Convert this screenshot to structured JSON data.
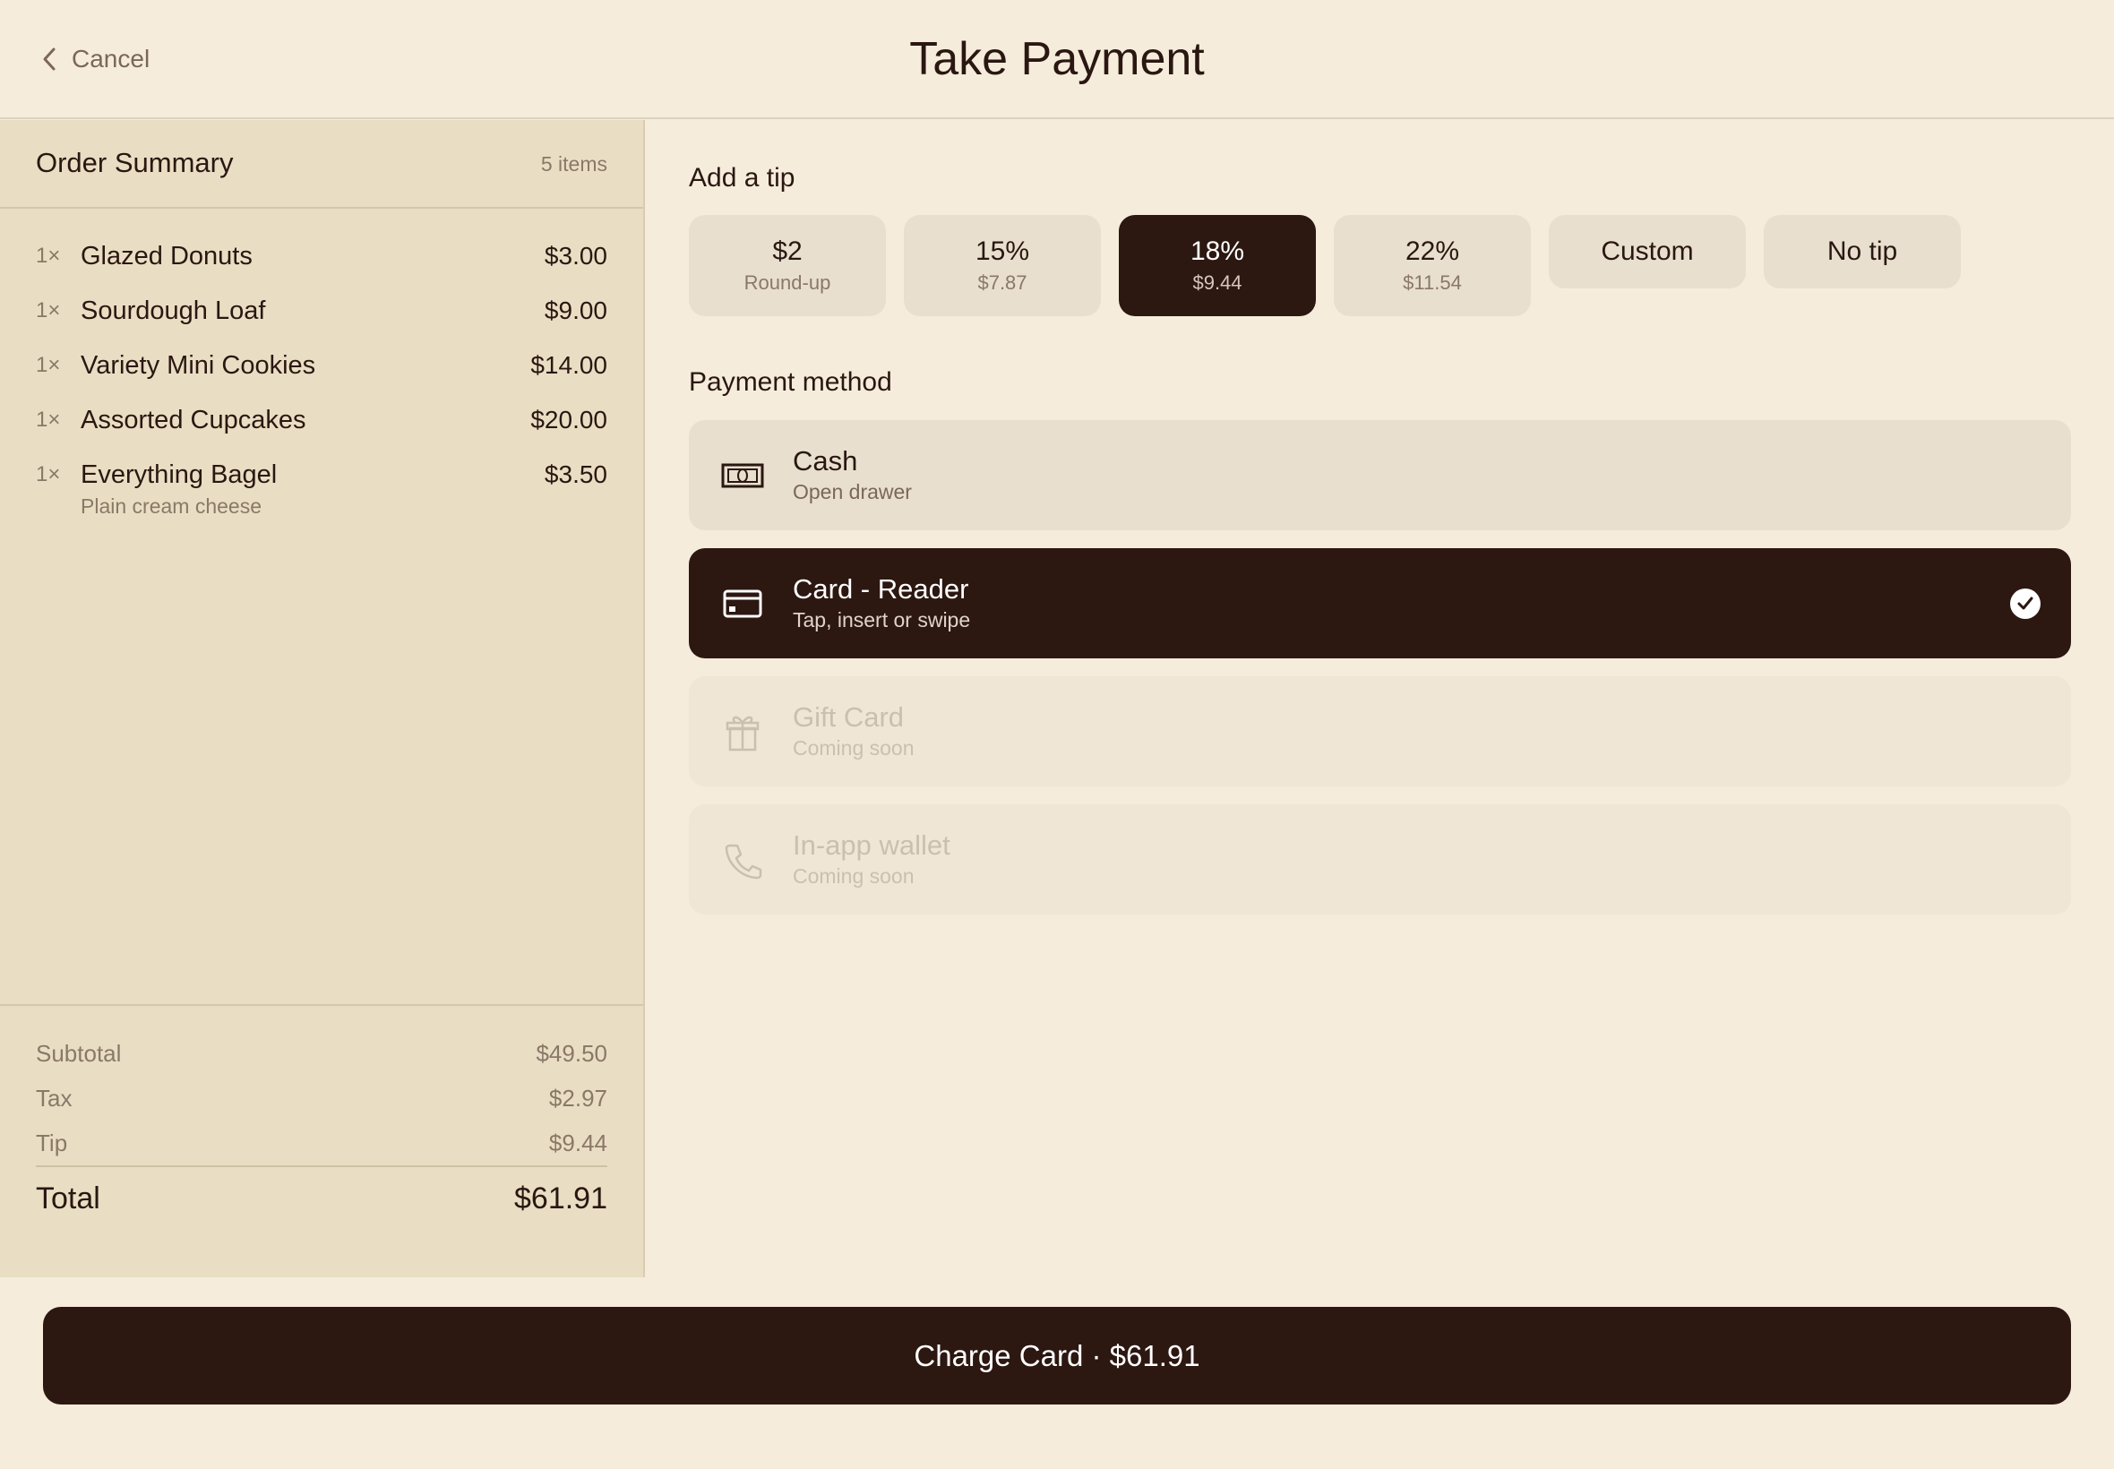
{
  "header": {
    "cancel_label": "Cancel",
    "title": "Take Payment"
  },
  "order_summary": {
    "title": "Order Summary",
    "count": "5 items",
    "items": [
      {
        "qty": "1×",
        "name": "Glazed Donuts",
        "price": "$3.00",
        "note": ""
      },
      {
        "qty": "1×",
        "name": "Sourdough Loaf",
        "price": "$9.00",
        "note": ""
      },
      {
        "qty": "1×",
        "name": "Variety Mini Cookies",
        "price": "$14.00",
        "note": ""
      },
      {
        "qty": "1×",
        "name": "Assorted Cupcakes",
        "price": "$20.00",
        "note": ""
      },
      {
        "qty": "1×",
        "name": "Everything Bagel",
        "price": "$3.50",
        "note": "Plain cream cheese"
      }
    ],
    "subtotal_label": "Subtotal",
    "subtotal_value": "$49.50",
    "tax_label": "Tax",
    "tax_value": "$2.97",
    "tip_label": "Tip",
    "tip_value": "$9.44",
    "total_label": "Total",
    "total_value": "$61.91"
  },
  "tip": {
    "label": "Add a tip",
    "options": [
      {
        "main": "$2",
        "sub": "Round-up"
      },
      {
        "main": "15%",
        "sub": "$7.87"
      },
      {
        "main": "18%",
        "sub": "$9.44",
        "selected": true
      },
      {
        "main": "22%",
        "sub": "$11.54"
      },
      {
        "main": "Custom",
        "sub": ""
      },
      {
        "main": "No tip",
        "sub": ""
      }
    ]
  },
  "payment": {
    "label": "Payment method",
    "methods": [
      {
        "title": "Cash",
        "subtitle": "Open drawer",
        "icon": "cash-icon",
        "state": "available"
      },
      {
        "title": "Card - Reader",
        "subtitle": "Tap, insert or swipe",
        "icon": "card-icon",
        "state": "selected"
      },
      {
        "title": "Gift Card",
        "subtitle": "Coming soon",
        "icon": "gift-icon",
        "state": "disabled"
      },
      {
        "title": "In-app wallet",
        "subtitle": "Coming soon",
        "icon": "phone-icon",
        "state": "disabled"
      }
    ]
  },
  "footer": {
    "charge_label": "Charge Card · $61.91"
  },
  "colors": {
    "background": "#f5ecdc",
    "panel": "#e9dec3",
    "accent_dark": "#2c1711",
    "muted_text": "#8a7868"
  }
}
